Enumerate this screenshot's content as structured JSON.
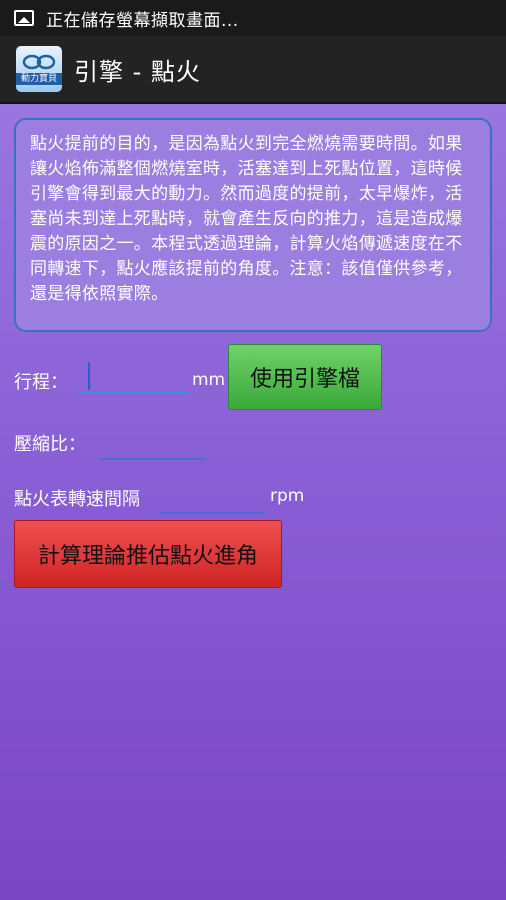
{
  "status_bar": {
    "notification_text": "正在儲存螢幕擷取畫面..."
  },
  "action_bar": {
    "app_icon_text": "動力寶貝",
    "title": "引擎 - 點火"
  },
  "info": {
    "text": "點火提前的目的，是因為點火到完全燃燒需要時間。如果讓火焰佈滿整個燃燒室時，活塞達到上死點位置，這時候引擎會得到最大的動力。然而過度的提前，太早爆炸，活塞尚未到達上死點時，就會產生反向的推力，這是造成爆震的原因之一。本程式透過理論，計算火焰傳遞速度在不同轉速下，點火應該提前的角度。注意：該值僅供參考，還是得依照實際。"
  },
  "form": {
    "stroke_label": "行程：",
    "stroke_value": "",
    "stroke_unit": "mm",
    "use_engine_file_button": "使用引擎檔",
    "compression_label": "壓縮比：",
    "compression_value": "",
    "rpm_interval_label": "點火表轉速間隔",
    "rpm_interval_value": "",
    "rpm_unit": "rpm",
    "calculate_button": "計算理論推估點火進角"
  }
}
